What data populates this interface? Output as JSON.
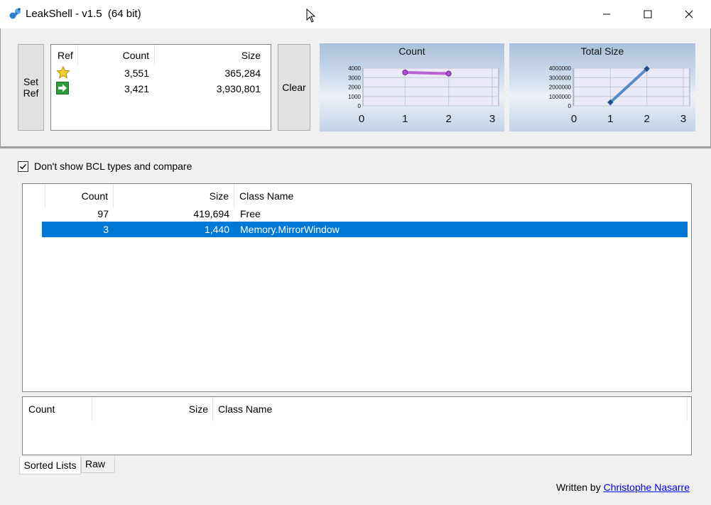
{
  "window": {
    "title": "LeakShell - v1.5  (64 bit)",
    "controls": [
      "minimize-icon",
      "maximize-icon",
      "close-icon"
    ]
  },
  "toolbar": {
    "set_ref_label_line1": "Set",
    "set_ref_label_line2": "Ref",
    "clear_label": "Clear"
  },
  "snapshot_table": {
    "headers": {
      "ref": "Ref",
      "count": "Count",
      "size": "Size"
    },
    "rows": [
      {
        "icon": "star-icon",
        "count": "3,551",
        "size": "365,284"
      },
      {
        "icon": "green-arrow-icon",
        "count": "3,421",
        "size": "3,930,801"
      }
    ]
  },
  "filter": {
    "checkbox_checked": true,
    "label": "Don't show BCL types and compare"
  },
  "main_list": {
    "headers": {
      "count": "Count",
      "size": "Size",
      "class_name": "Class Name"
    },
    "rows": [
      {
        "count": "97",
        "size": "419,694",
        "class_name": "Free",
        "selected": false
      },
      {
        "count": "3",
        "size": "1,440",
        "class_name": "Memory.MirrorWindow",
        "selected": true
      }
    ]
  },
  "detail_list": {
    "headers": {
      "count": "Count",
      "size": "Size",
      "class_name": "Class Name"
    }
  },
  "tabs": [
    {
      "label": "Sorted Lists",
      "active": true
    },
    {
      "label": "Raw",
      "active": false
    }
  ],
  "footer": {
    "written_by": "Written by",
    "author": "Christophe Nasarre"
  },
  "colors": {
    "selection": "#0078d7",
    "count_line": "#b04ad0",
    "size_line": "#3e7bc0"
  },
  "chart_data": [
    {
      "type": "line",
      "title": "Count",
      "x": [
        1,
        2
      ],
      "values": [
        3551,
        3421
      ],
      "xlim": [
        0,
        3
      ],
      "ylim": [
        0,
        4000
      ],
      "x_ticks": [
        "0",
        "1",
        "2",
        "3"
      ],
      "y_ticks": [
        "4000",
        "3000",
        "2000",
        "1000",
        "0"
      ],
      "grid": true
    },
    {
      "type": "line",
      "title": "Total Size",
      "x": [
        1,
        2
      ],
      "values": [
        365284,
        3930801
      ],
      "xlim": [
        0,
        3
      ],
      "ylim": [
        0,
        4000000
      ],
      "x_ticks": [
        "0",
        "1",
        "2",
        "3"
      ],
      "y_ticks": [
        "4000000",
        "3000000",
        "2000000",
        "1000000",
        "0"
      ],
      "grid": true
    }
  ]
}
